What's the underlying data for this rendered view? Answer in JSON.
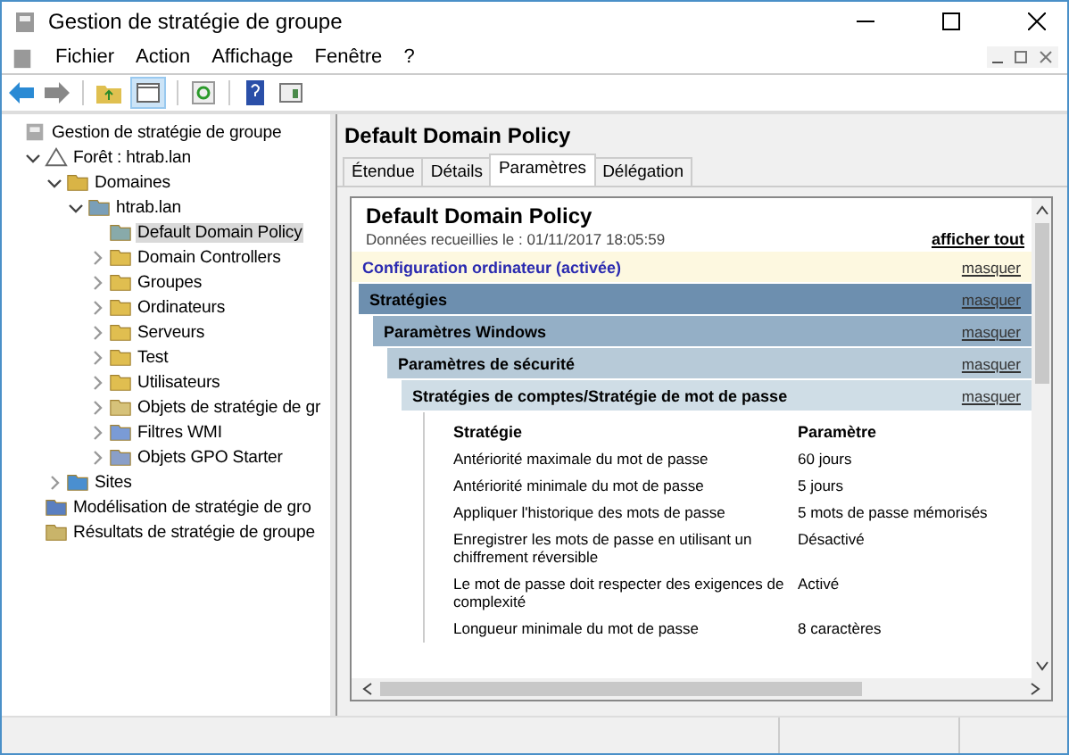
{
  "window": {
    "title": "Gestion de stratégie de groupe"
  },
  "menu": [
    "Fichier",
    "Action",
    "Affichage",
    "Fenêtre",
    "?"
  ],
  "tree": [
    {
      "label": "Gestion de stratégie de groupe",
      "selected": false,
      "children": [
        {
          "label": "Forêt : htrab.lan",
          "expanded": true,
          "selected": false,
          "children": [
            {
              "label": "Domaines",
              "expanded": true,
              "selected": false,
              "children": [
                {
                  "label": "htrab.lan",
                  "expanded": true,
                  "selected": false,
                  "children": [
                    {
                      "label": "Default Domain Policy",
                      "selected": true
                    },
                    {
                      "label": "Domain Controllers",
                      "expanded": false,
                      "selected": false
                    },
                    {
                      "label": "Groupes",
                      "expanded": false,
                      "selected": false
                    },
                    {
                      "label": "Ordinateurs",
                      "expanded": false,
                      "selected": false
                    },
                    {
                      "label": "Serveurs",
                      "expanded": false,
                      "selected": false
                    },
                    {
                      "label": "Test",
                      "expanded": false,
                      "selected": false
                    },
                    {
                      "label": "Utilisateurs",
                      "expanded": false,
                      "selected": false
                    },
                    {
                      "label": "Objets de stratégie de gr",
                      "expanded": false,
                      "selected": false
                    },
                    {
                      "label": "Filtres WMI",
                      "expanded": false,
                      "selected": false
                    },
                    {
                      "label": "Objets GPO Starter",
                      "expanded": false,
                      "selected": false
                    }
                  ]
                }
              ]
            },
            {
              "label": "Sites",
              "expanded": false,
              "selected": false
            }
          ]
        },
        {
          "label": "Modélisation de stratégie de gro",
          "selected": false
        },
        {
          "label": "Résultats de stratégie de groupe",
          "selected": false
        }
      ]
    }
  ],
  "details": {
    "heading": "Default Domain Policy",
    "tabs": [
      {
        "label": "Étendue",
        "selected": false
      },
      {
        "label": "Détails",
        "selected": false
      },
      {
        "label": "Paramètres",
        "selected": true
      },
      {
        "label": "Délégation",
        "selected": false
      }
    ],
    "report": {
      "title": "Default Domain Policy",
      "collected": "Données recueillies le : 01/11/2017 18:05:59",
      "show_all": "afficher tout",
      "section": {
        "label": "Configuration ordinateur (activée)",
        "toggle": "masquer",
        "children": [
          {
            "label": "Stratégies",
            "toggle": "masquer",
            "children": [
              {
                "label": "Paramètres Windows",
                "toggle": "masquer",
                "children": [
                  {
                    "label": "Paramètres de sécurité",
                    "toggle": "masquer",
                    "children": [
                      {
                        "label": "Stratégies de comptes/Stratégie de mot de passe",
                        "toggle": "masquer"
                      }
                    ]
                  }
                ]
              }
            ]
          }
        ]
      },
      "table": {
        "columns": [
          "Stratégie",
          "Paramètre"
        ],
        "rows": [
          [
            "Antériorité maximale du mot de passe",
            "60 jours"
          ],
          [
            "Antériorité minimale du mot de passe",
            "5 jours"
          ],
          [
            "Appliquer l'historique des mots de passe",
            "5 mots de passe mémorisés"
          ],
          [
            "Enregistrer les mots de passe en utilisant un chiffrement réversible",
            "Désactivé"
          ],
          [
            "Le mot de passe doit respecter des exigences de complexité",
            "Activé"
          ],
          [
            "Longueur minimale du mot de passe",
            "8 caractères"
          ]
        ]
      }
    }
  }
}
